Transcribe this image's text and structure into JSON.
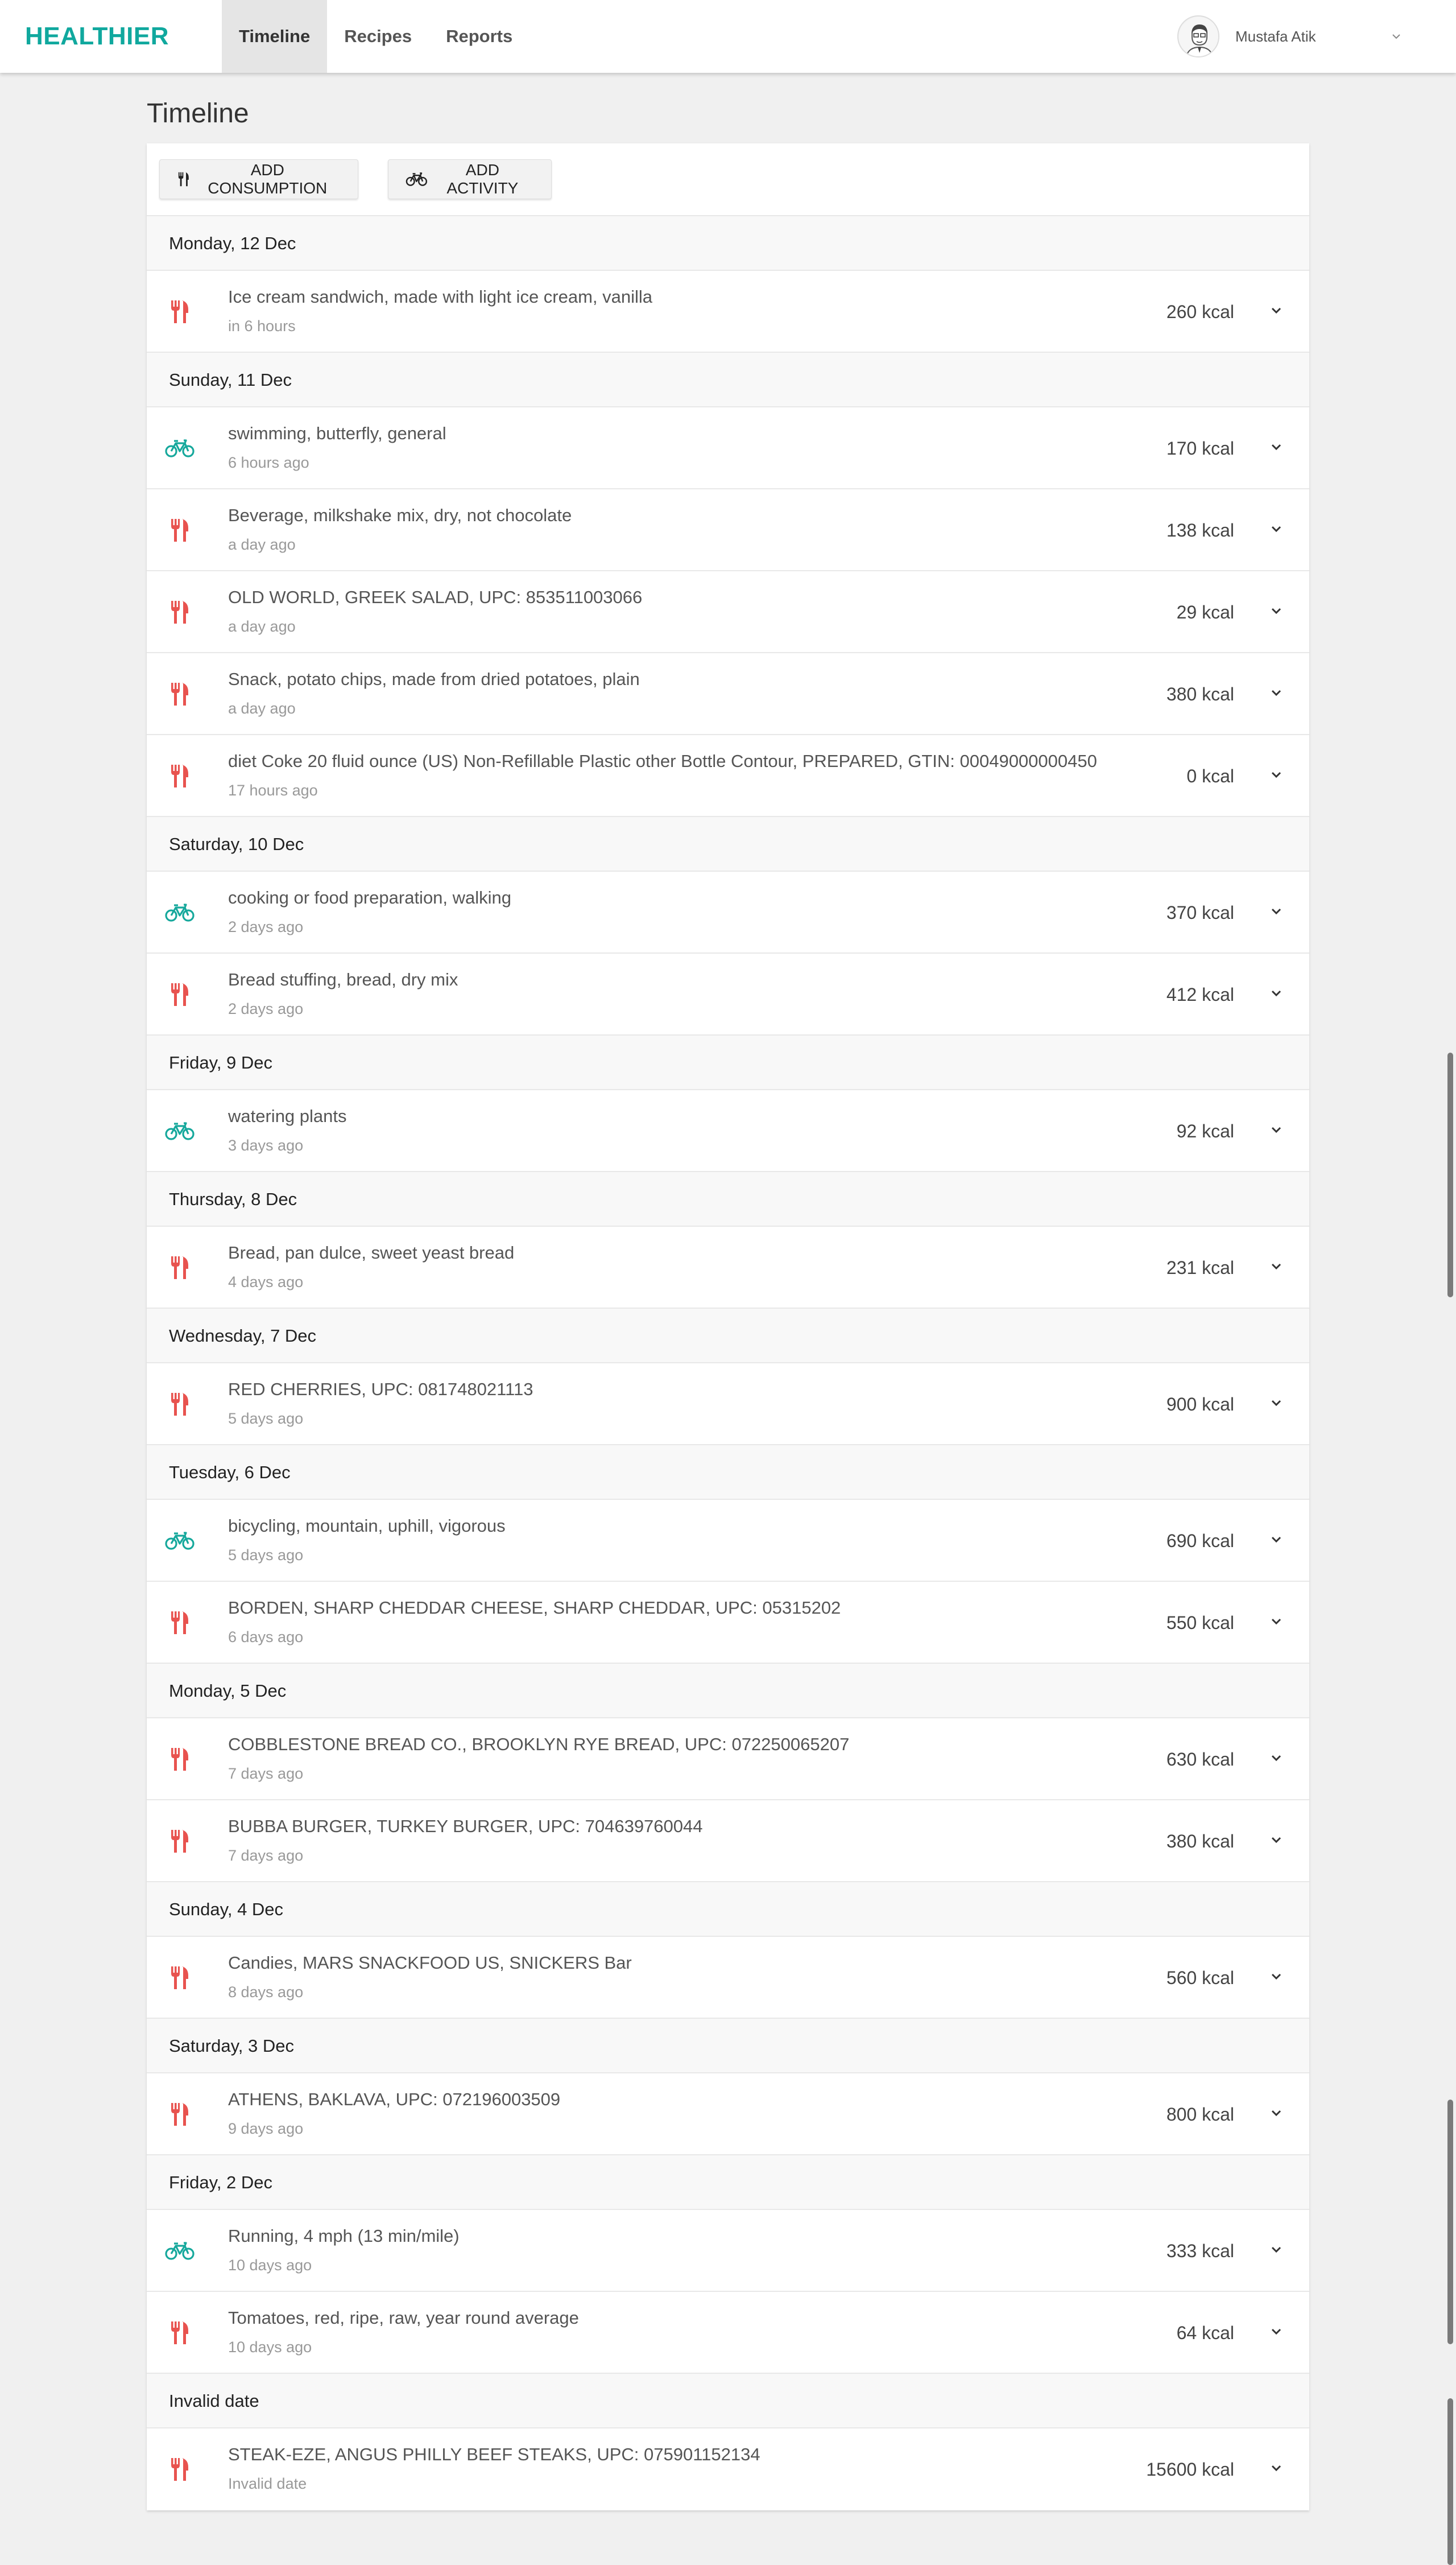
{
  "app": {
    "logo": "HEALTHIER"
  },
  "nav": [
    {
      "label": "Timeline",
      "active": true
    },
    {
      "label": "Recipes",
      "active": false
    },
    {
      "label": "Reports",
      "active": false
    }
  ],
  "user": {
    "name": "Mustafa Atik",
    "avatar_icon": "user-avatar-icon"
  },
  "page": {
    "title": "Timeline"
  },
  "toolbar": {
    "add_consumption_label": "ADD CONSUMPTION",
    "add_activity_label": "ADD ACTIVITY"
  },
  "colors": {
    "accent": "#10a89e",
    "consumption_icon": "#e8534f",
    "activity_icon": "#16a89c"
  },
  "groups": [
    {
      "date": "Monday, 12 Dec",
      "entries": [
        {
          "type": "consumption",
          "name": "Ice cream sandwich, made with light ice cream, vanilla",
          "time": "in 6 hours",
          "kcal": "260 kcal"
        }
      ]
    },
    {
      "date": "Sunday, 11 Dec",
      "entries": [
        {
          "type": "activity",
          "name": "swimming, butterfly, general",
          "time": "6 hours ago",
          "kcal": "170 kcal"
        },
        {
          "type": "consumption",
          "name": "Beverage, milkshake mix, dry, not chocolate",
          "time": "a day ago",
          "kcal": "138 kcal"
        },
        {
          "type": "consumption",
          "name": "OLD WORLD, GREEK SALAD, UPC: 853511003066",
          "time": "a day ago",
          "kcal": "29 kcal"
        },
        {
          "type": "consumption",
          "name": "Snack, potato chips, made from dried potatoes, plain",
          "time": "a day ago",
          "kcal": "380 kcal"
        },
        {
          "type": "consumption",
          "name": "diet Coke 20 fluid ounce (US) Non-Refillable Plastic other Bottle Contour, PREPARED, GTIN: 00049000000450",
          "time": "17 hours ago",
          "kcal": "0 kcal"
        }
      ]
    },
    {
      "date": "Saturday, 10 Dec",
      "entries": [
        {
          "type": "activity",
          "name": "cooking or food preparation, walking",
          "time": "2 days ago",
          "kcal": "370 kcal"
        },
        {
          "type": "consumption",
          "name": "Bread stuffing, bread, dry mix",
          "time": "2 days ago",
          "kcal": "412 kcal"
        }
      ]
    },
    {
      "date": "Friday, 9 Dec",
      "entries": [
        {
          "type": "activity",
          "name": "watering plants",
          "time": "3 days ago",
          "kcal": "92 kcal"
        }
      ]
    },
    {
      "date": "Thursday, 8 Dec",
      "entries": [
        {
          "type": "consumption",
          "name": "Bread, pan dulce, sweet yeast bread",
          "time": "4 days ago",
          "kcal": "231 kcal"
        }
      ]
    },
    {
      "date": "Wednesday, 7 Dec",
      "entries": [
        {
          "type": "consumption",
          "name": "RED CHERRIES, UPC: 081748021113",
          "time": "5 days ago",
          "kcal": "900 kcal"
        }
      ]
    },
    {
      "date": "Tuesday, 6 Dec",
      "entries": [
        {
          "type": "activity",
          "name": "bicycling, mountain, uphill, vigorous",
          "time": "5 days ago",
          "kcal": "690 kcal"
        },
        {
          "type": "consumption",
          "name": "BORDEN, SHARP CHEDDAR CHEESE, SHARP CHEDDAR, UPC: 05315202",
          "time": "6 days ago",
          "kcal": "550 kcal"
        }
      ]
    },
    {
      "date": "Monday, 5 Dec",
      "entries": [
        {
          "type": "consumption",
          "name": "COBBLESTONE BREAD CO., BROOKLYN RYE BREAD, UPC: 072250065207",
          "time": "7 days ago",
          "kcal": "630 kcal"
        },
        {
          "type": "consumption",
          "name": "BUBBA BURGER, TURKEY BURGER, UPC: 704639760044",
          "time": "7 days ago",
          "kcal": "380 kcal"
        }
      ]
    },
    {
      "date": "Sunday, 4 Dec",
      "entries": [
        {
          "type": "consumption",
          "name": "Candies, MARS SNACKFOOD US, SNICKERS Bar",
          "time": "8 days ago",
          "kcal": "560 kcal"
        }
      ]
    },
    {
      "date": "Saturday, 3 Dec",
      "entries": [
        {
          "type": "consumption",
          "name": "ATHENS, BAKLAVA, UPC: 072196003509",
          "time": "9 days ago",
          "kcal": "800 kcal"
        }
      ]
    },
    {
      "date": "Friday, 2 Dec",
      "entries": [
        {
          "type": "activity",
          "name": "Running, 4 mph (13 min/mile)",
          "time": "10 days ago",
          "kcal": "333 kcal"
        },
        {
          "type": "consumption",
          "name": "Tomatoes, red, ripe, raw, year round average",
          "time": "10 days ago",
          "kcal": "64 kcal"
        }
      ]
    },
    {
      "date": "Invalid date",
      "entries": [
        {
          "type": "consumption",
          "name": "STEAK-EZE, ANGUS PHILLY BEEF STEAKS, UPC: 075901152134",
          "time": "Invalid date",
          "kcal": "15600 kcal"
        }
      ]
    }
  ]
}
